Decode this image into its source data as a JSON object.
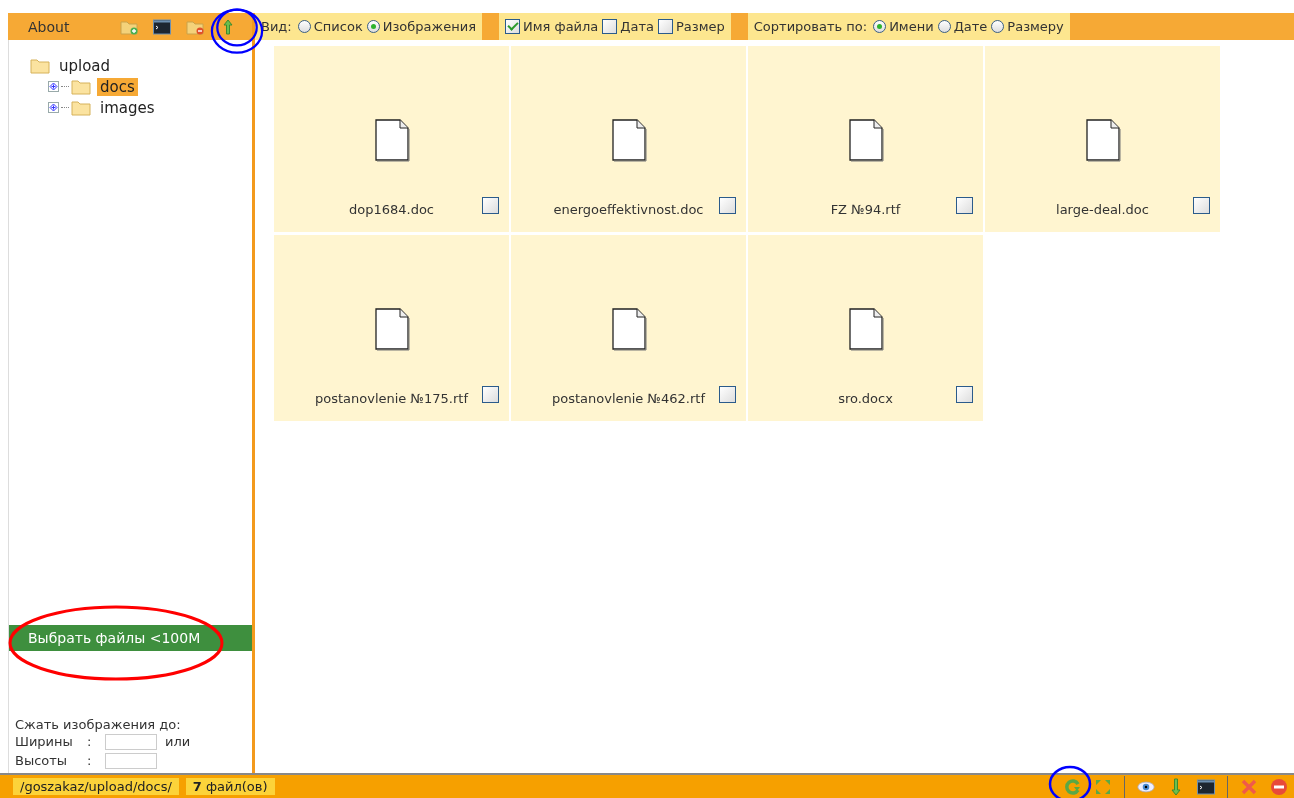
{
  "sidebar": {
    "title": "About",
    "tree": [
      {
        "label": "upload",
        "selected": false,
        "children": [
          {
            "label": "docs",
            "selected": true,
            "expanded": false
          },
          {
            "label": "images",
            "selected": false,
            "expanded": false
          }
        ]
      }
    ],
    "upload_button": "Выбрать файлы <100M",
    "resize": {
      "title": "Сжать изображения до:",
      "fields": [
        {
          "label": "Ширины",
          "separator": ":",
          "suffix": "или"
        },
        {
          "label": "Высоты",
          "separator": ":"
        }
      ]
    }
  },
  "toolbar": {
    "view": {
      "label": "Вид:",
      "options": [
        {
          "label": "Список",
          "selected": false
        },
        {
          "label": "Изображения",
          "selected": true
        }
      ]
    },
    "show": [
      {
        "label": "Имя файла",
        "checked": true
      },
      {
        "label": "Дата",
        "checked": false
      },
      {
        "label": "Размер",
        "checked": false
      }
    ],
    "sort": {
      "label": "Сортировать по:",
      "options": [
        {
          "label": "Имени",
          "selected": true
        },
        {
          "label": "Дате",
          "selected": false
        },
        {
          "label": "Размеру",
          "selected": false
        }
      ]
    }
  },
  "files": [
    {
      "name": "dop1684.doc",
      "checked": false
    },
    {
      "name": "energoeffektivnost.doc",
      "checked": false
    },
    {
      "name": "FZ №94.rtf",
      "checked": false
    },
    {
      "name": "large-deal.doc",
      "checked": false
    },
    {
      "name": "postanovlenie №175.rtf",
      "checked": false
    },
    {
      "name": "postanovlenie №462.rtf",
      "checked": false
    },
    {
      "name": "sro.docx",
      "checked": false
    }
  ],
  "status_bar": {
    "path": "/goszakaz/upload/docs/",
    "count": "**7** файл(ов)"
  }
}
